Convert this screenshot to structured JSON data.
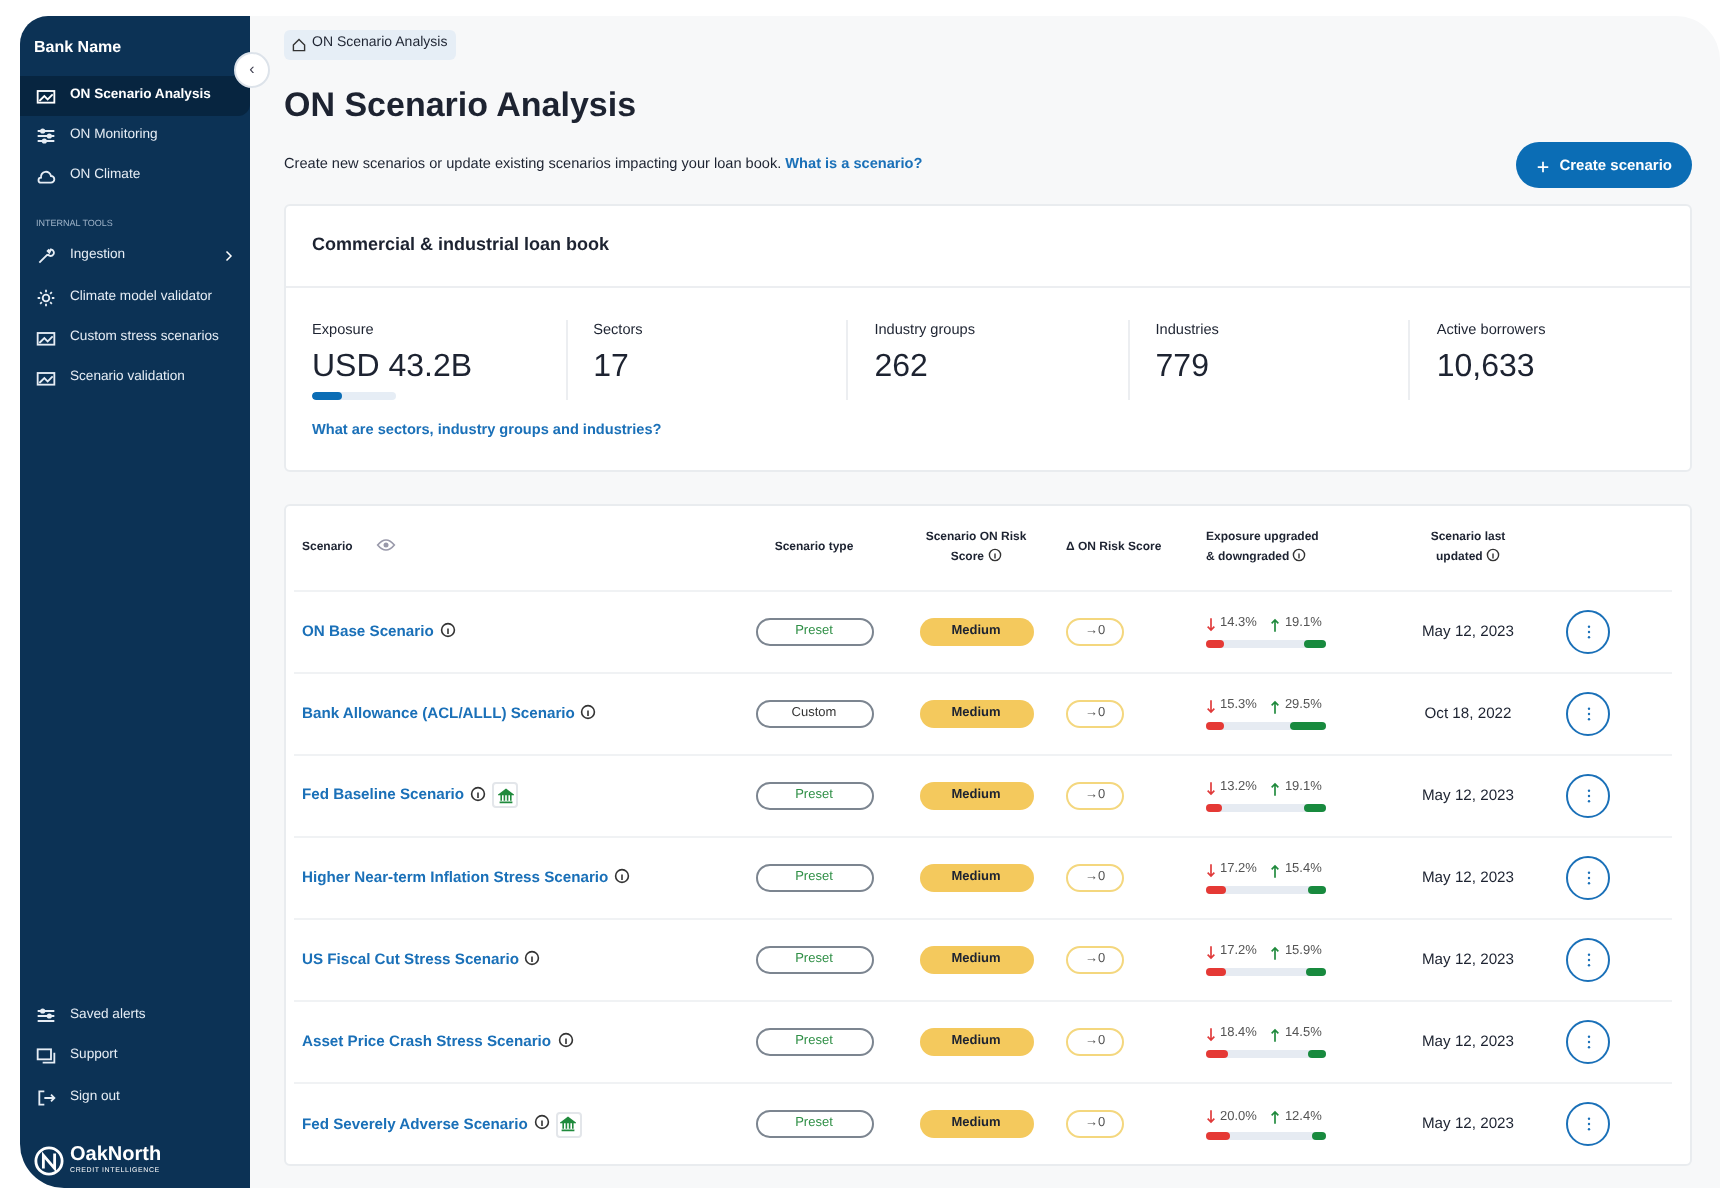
{
  "sidebar": {
    "title": "Bank Name",
    "collapse_button": "‹",
    "items": [
      {
        "label": "ON Scenario Analysis",
        "selected": true
      },
      {
        "label": "ON Monitoring",
        "selected": false
      },
      {
        "label": "ON Climate",
        "selected": false
      }
    ],
    "section_label": "INTERNAL TOOLS",
    "tools": [
      {
        "label": "Ingestion",
        "selected": false,
        "expanded": false
      },
      {
        "label": "Climate model validator",
        "selected": false
      },
      {
        "label": "Custom stress scenarios",
        "selected": false
      },
      {
        "label": "Scenario validation",
        "selected": false
      }
    ],
    "footer_items": [
      {
        "label": "Saved alerts"
      },
      {
        "label": "Support"
      },
      {
        "label": "Sign out"
      }
    ],
    "logo": {
      "name": "OakNorth",
      "tagline": "CREDIT INTELLIGENCE"
    }
  },
  "breadcrumb": "ON Scenario Analysis",
  "title": "ON Scenario Analysis",
  "subtitle": "Create new scenarios or update existing scenarios impacting your loan book.",
  "subtitle_link": "What is a scenario?",
  "create_button": "Create scenario",
  "loan_book": {
    "title": "Commercial & industrial loan book",
    "stats": [
      {
        "label": "Exposure",
        "value": "USD 43.2B",
        "level": 0.36
      },
      {
        "label": "Sectors",
        "value": "17"
      },
      {
        "label": "Industry groups",
        "value": "262"
      },
      {
        "label": "Industries",
        "value": "779"
      },
      {
        "label": "Active borrowers",
        "value": "10,633"
      }
    ],
    "link": "What are sectors, industry groups and industries?"
  },
  "table": {
    "columns": [
      "Scenario",
      "Scenario type",
      "Scenario ON Risk Score",
      "Δ ON Risk Score",
      "Exposure upgraded & downgraded",
      "Scenario last updated"
    ],
    "rows": [
      {
        "name": "ON Base Scenario",
        "flagged": false,
        "type": "Preset",
        "kind": "preset",
        "score": "Medium",
        "delta": "→0",
        "down": {
          "text": "14.3%",
          "level": 0.143
        },
        "up": {
          "text": "19.1%",
          "level": 0.191
        },
        "updated": "May 12, 2023"
      },
      {
        "name": "Bank Allowance (ACL/ALLL) Scenario",
        "flagged": false,
        "type": "Custom",
        "kind": "custom",
        "score": "Medium",
        "delta": "→0",
        "down": {
          "text": "15.3%",
          "level": 0.153
        },
        "up": {
          "text": "29.5%",
          "level": 0.295
        },
        "updated": "Oct 18, 2022"
      },
      {
        "name": "Fed Baseline Scenario",
        "flagged": true,
        "type": "Preset",
        "kind": "preset",
        "score": "Medium",
        "delta": "→0",
        "down": {
          "text": "13.2%",
          "level": 0.132
        },
        "up": {
          "text": "19.1%",
          "level": 0.191
        },
        "updated": "May 12, 2023"
      },
      {
        "name": "Higher Near-term Inflation Stress Scenario",
        "flagged": false,
        "type": "Preset",
        "kind": "preset",
        "score": "Medium",
        "delta": "→0",
        "down": {
          "text": "17.2%",
          "level": 0.172
        },
        "up": {
          "text": "15.4%",
          "level": 0.154
        },
        "updated": "May 12, 2023"
      },
      {
        "name": "US Fiscal Cut Stress Scenario",
        "flagged": false,
        "type": "Preset",
        "kind": "preset",
        "score": "Medium",
        "delta": "→0",
        "down": {
          "text": "17.2%",
          "level": 0.172
        },
        "up": {
          "text": "15.9%",
          "level": 0.159
        },
        "updated": "May 12, 2023"
      },
      {
        "name": "Asset Price Crash Stress Scenario",
        "flagged": false,
        "type": "Preset",
        "kind": "preset",
        "score": "Medium",
        "delta": "→0",
        "down": {
          "text": "18.4%",
          "level": 0.184
        },
        "up": {
          "text": "14.5%",
          "level": 0.145
        },
        "updated": "May 12, 2023"
      },
      {
        "name": "Fed Severely Adverse Scenario",
        "flagged": true,
        "type": "Preset",
        "kind": "preset",
        "score": "Medium",
        "delta": "→0",
        "down": {
          "text": "20.0%",
          "level": 0.2
        },
        "up": {
          "text": "12.4%",
          "level": 0.124
        },
        "updated": "May 12, 2023"
      }
    ]
  }
}
